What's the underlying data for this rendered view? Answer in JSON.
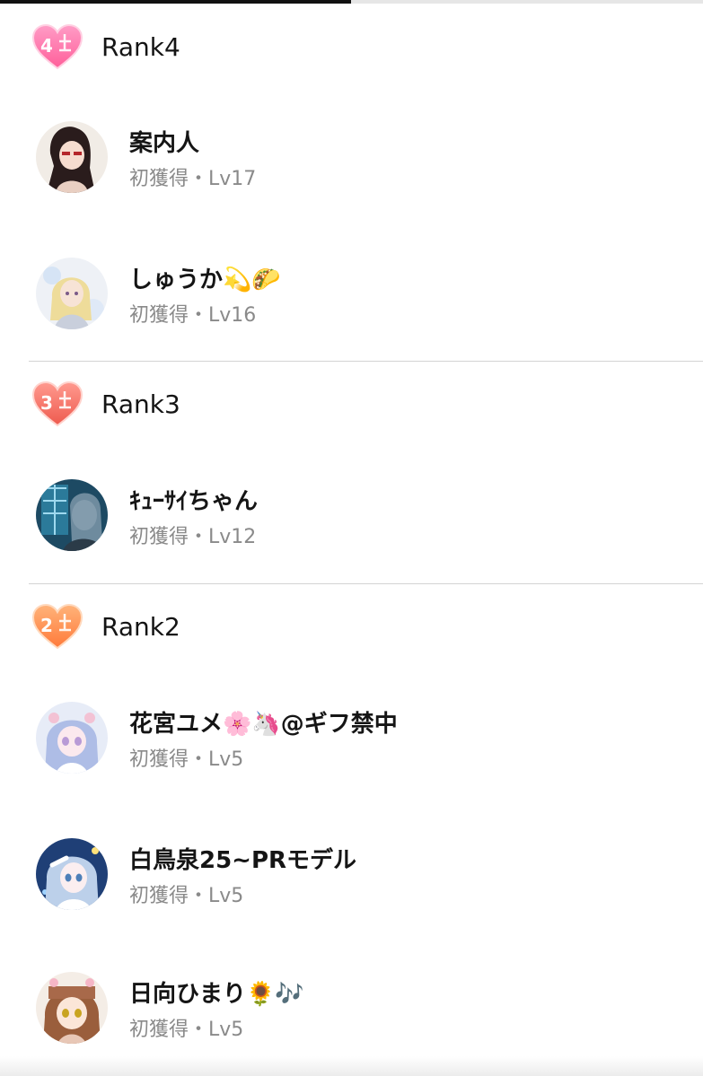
{
  "progress": {
    "fraction": 0.5
  },
  "icons": {
    "rank_heart": "rank-heart-icon"
  },
  "colors": {
    "rank4": "#ff6fa7",
    "rank3": "#f2655c",
    "rank2": "#ff8c4a",
    "subtext": "#8a8a8a",
    "divider": "#d4d4d4"
  },
  "ranks": [
    {
      "number": "4",
      "title": "Rank4",
      "users": [
        {
          "name": "案内人",
          "sub": "初獲得・Lv17"
        },
        {
          "name": "しゅうか💫🌮",
          "sub": "初獲得・Lv16"
        }
      ]
    },
    {
      "number": "3",
      "title": "Rank3",
      "users": [
        {
          "name": "ｷｭｰｻｲちゃん",
          "sub": "初獲得・Lv12"
        }
      ]
    },
    {
      "number": "2",
      "title": "Rank2",
      "users": [
        {
          "name": "花宮ユメ🌸🦄@ギフ禁中",
          "sub": "初獲得・Lv5"
        },
        {
          "name": "白鳥泉25~PRモデル",
          "sub": "初獲得・Lv5"
        },
        {
          "name": "日向ひまり🌻🎶",
          "sub": "初獲得・Lv5"
        }
      ]
    }
  ]
}
